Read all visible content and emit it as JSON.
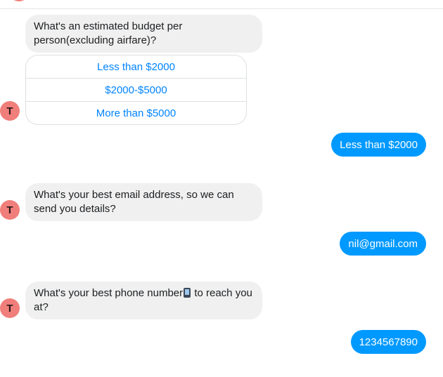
{
  "colors": {
    "bot_bubble_bg": "#f0f0f0",
    "user_bubble_bg": "#0099ff",
    "quick_reply_text": "#0084ff",
    "avatar_bg": "#f07e7a"
  },
  "bot": {
    "avatar_letter": "T"
  },
  "messages": {
    "q1": {
      "text": "What's an estimated budget per person(excluding airfare)?",
      "quick_replies": [
        "Less than $2000",
        "$2000-$5000",
        "More than $5000"
      ]
    },
    "a1": "Less than $2000",
    "q2": "What's your best email address, so we can send you details?",
    "a2": "nil@gmail.com",
    "q3": {
      "before_icon": "What's your best phone number",
      "icon": "mobile-phone-arrow-icon",
      "after_icon": " to reach you at?"
    },
    "a3": "1234567890"
  }
}
